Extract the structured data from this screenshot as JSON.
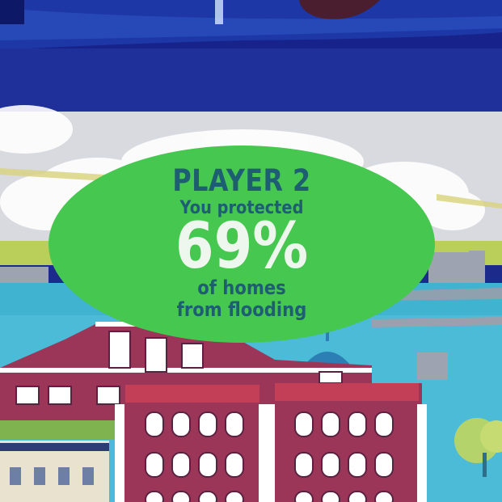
{
  "result_card": {
    "player": "PLAYER 2",
    "protected_text": "You protected",
    "percentage": "69%",
    "line_1": "of homes",
    "line_2": "from flooding"
  },
  "colors": {
    "card_green": "#46c74f",
    "text_teal": "#1e5e72",
    "percent_white": "#eef7ee",
    "water_blue": "#3fb3cf",
    "sky": "#d9dadf",
    "frame_blue": "#1c2a8c",
    "building_red": "#9c3659"
  }
}
